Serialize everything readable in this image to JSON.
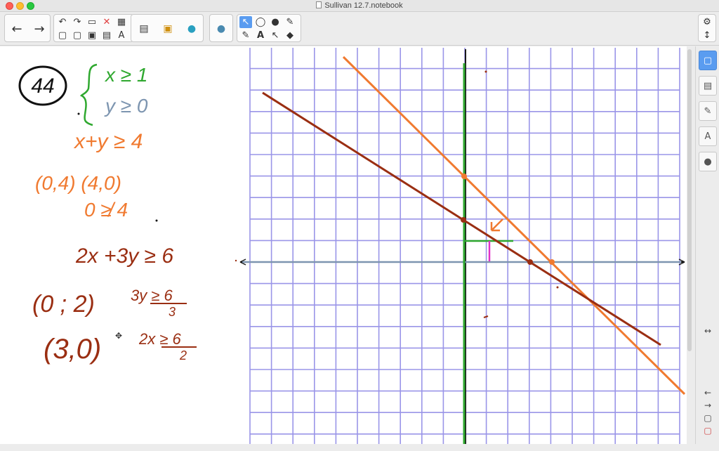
{
  "window": {
    "title": "Sullivan 12.7.notebook"
  },
  "toolbar": {
    "back_icon": "←",
    "forward_icon": "→",
    "undo_icon": "↶",
    "redo_icon": "↷",
    "delete_icon": "✕",
    "table_icon": "▦",
    "new_page_icon": "▢",
    "open_icon": "▭",
    "save_icon": "▣",
    "screen_icon": "▤",
    "text_icon": "A",
    "cursor_icon": "↖",
    "shape_icon": "◯",
    "fill_icon": "●",
    "pen_icon": "✎",
    "eraser_icon": "◆",
    "gear_icon": "⚙",
    "updown_icon": "↕"
  },
  "notes": {
    "problem_number": "44",
    "line1": "x ≥ 1",
    "line2": "y ≥ 0",
    "line3": "x+y ≥ 4",
    "line4": "(0,4) (4,0)",
    "line5": "0 ≱ 4",
    "line6": "2x +3y ≥ 6",
    "line7a": "(0 ; 2)",
    "line7b": "3y ≥ 6",
    "line7c": "3",
    "line8a": "(3,0)",
    "line8b": "2x ≥ 6",
    "line8c": "2"
  },
  "sidebar": {
    "collapse_icon": "↔",
    "prev_icon": "←",
    "next_icon": "→"
  },
  "colors": {
    "grid": "#9a95e8",
    "axis": "#1a1a1a",
    "green": "#2fa82f",
    "orange": "#f07a30",
    "brown": "#9a2e12",
    "blue_gray": "#7d95b0",
    "magenta": "#e030c8"
  }
}
